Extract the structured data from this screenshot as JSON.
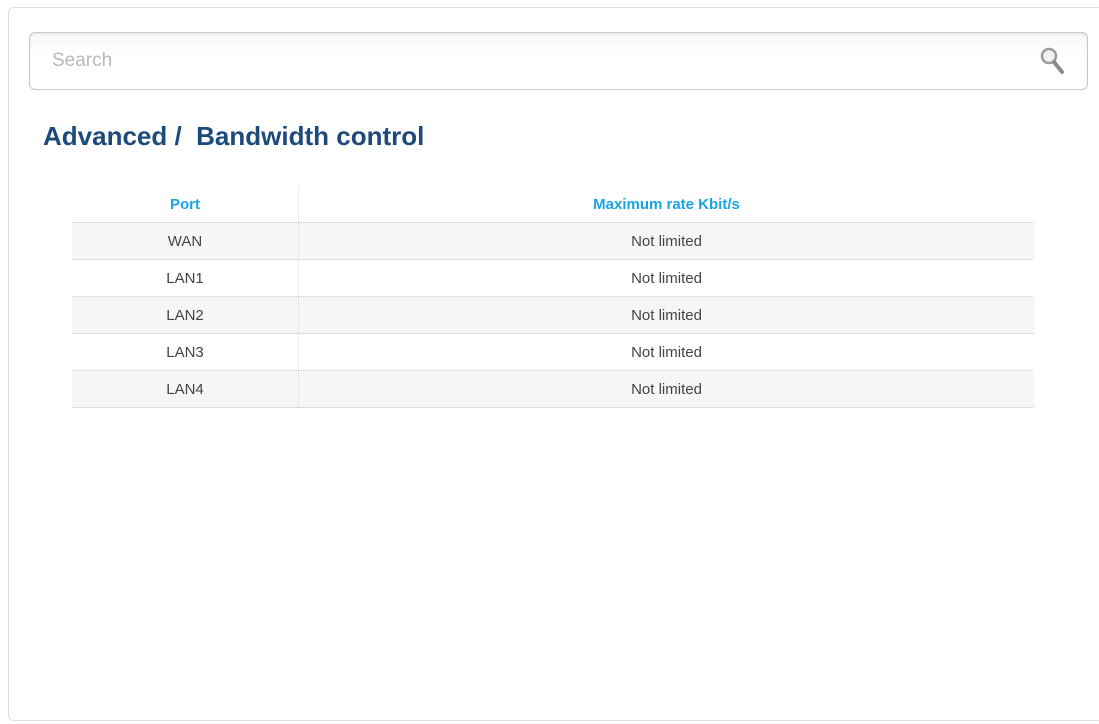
{
  "search": {
    "placeholder": "Search",
    "icon": "search-icon"
  },
  "page": {
    "title": "Advanced /  Bandwidth control",
    "title_color": "#1d4a7b"
  },
  "table": {
    "header_color": "#1aa3e3",
    "columns": [
      "Port",
      "Maximum rate Kbit/s"
    ],
    "rows": [
      {
        "port": "WAN",
        "rate": "Not limited"
      },
      {
        "port": "LAN1",
        "rate": "Not limited"
      },
      {
        "port": "LAN2",
        "rate": "Not limited"
      },
      {
        "port": "LAN3",
        "rate": "Not limited"
      },
      {
        "port": "LAN4",
        "rate": "Not limited"
      }
    ]
  }
}
